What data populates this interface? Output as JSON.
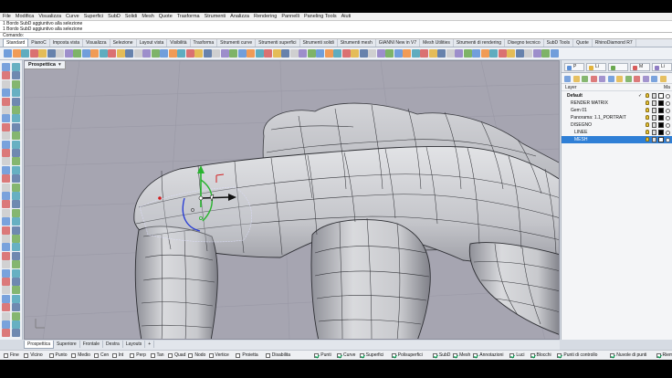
{
  "menu": [
    "File",
    "Modifica",
    "Visualizza",
    "Curve",
    "Superfici",
    "SubD",
    "Solidi",
    "Mesh",
    "Quote",
    "Trasforma",
    "Strumenti",
    "Analizza",
    "Rendering",
    "Pannelli",
    "Paneling Tools",
    "Aiuti"
  ],
  "command_history": [
    "1 Bordo SubD aggiuntivo alla selezione",
    "1 Bordo SubD aggiuntivo alla selezione"
  ],
  "command_prompt": "Comando:",
  "toolbar_tabs": [
    "Standard",
    "PianoC",
    "Imposta vista",
    "Visualizza",
    "Selezione",
    "Layout vista",
    "Visibilità",
    "Trasforma",
    "Strumenti curve",
    "Strumenti superfici",
    "Strumenti solidi",
    "Strumenti mesh",
    "GIANNI New in V7",
    "Mesh Utilities",
    "Strumenti di rendering",
    "Disegno tecnico",
    "SubD Tools",
    "Quote",
    "RhinoDiamond R7"
  ],
  "active_toolbar_tab": 0,
  "viewport": {
    "title": "Prospettica",
    "menu_glyph": "▾"
  },
  "viewport_tabs": [
    "Prospettica",
    "Superiore",
    "Frontale",
    "Destra",
    "Layouts",
    "+"
  ],
  "active_viewport_tab": 0,
  "panel": {
    "tabs": [
      "P",
      "Li",
      "",
      "M",
      "Li"
    ],
    "header": {
      "layer": "Layer",
      "material": "Ma"
    },
    "layers": [
      {
        "name": "Default",
        "indent": 0,
        "bold": true,
        "color": "#ffffff",
        "check": "✓",
        "selected": false
      },
      {
        "name": "RENDER MATRIX",
        "indent": 1,
        "bold": false,
        "color": "#000000",
        "check": "",
        "selected": false
      },
      {
        "name": "Gem 01",
        "indent": 1,
        "bold": false,
        "color": "#000000",
        "check": "",
        "selected": false
      },
      {
        "name": "Panorama: 1.1_PORTRAIT",
        "indent": 1,
        "bold": false,
        "color": "#000000",
        "check": "",
        "selected": false
      },
      {
        "name": "DISEGNO",
        "indent": 1,
        "bold": false,
        "color": "#000000",
        "check": "",
        "selected": false
      },
      {
        "name": "LINEE",
        "indent": 2,
        "bold": false,
        "color": "#000000",
        "check": "",
        "selected": false
      },
      {
        "name": "MESH",
        "indent": 2,
        "bold": false,
        "color": "#ffffff",
        "check": "",
        "selected": true
      }
    ]
  },
  "osnaps": [
    {
      "label": "Fine",
      "on": false
    },
    {
      "label": "Vicino",
      "on": false
    },
    {
      "label": "Punto",
      "on": false
    },
    {
      "label": "Medio",
      "on": false
    },
    {
      "label": "Cen",
      "on": false
    },
    {
      "label": "Int",
      "on": false
    },
    {
      "label": "Perp",
      "on": false
    },
    {
      "label": "Tan",
      "on": false
    },
    {
      "label": "Quad",
      "on": false
    },
    {
      "label": "Nodo",
      "on": false
    },
    {
      "label": "Vertice",
      "on": false
    },
    {
      "label": "Proietta",
      "on": false
    },
    {
      "label": "Disabilita",
      "on": false
    }
  ],
  "filters": [
    {
      "label": "Punti",
      "on": true
    },
    {
      "label": "Curve",
      "on": true
    },
    {
      "label": "Superfici",
      "on": true
    },
    {
      "label": "Polisuperfici",
      "on": true
    },
    {
      "label": "SubD",
      "on": true
    },
    {
      "label": "Mesh",
      "on": true
    },
    {
      "label": "Annotazioni",
      "on": true
    },
    {
      "label": "Luci",
      "on": true
    },
    {
      "label": "Blocchi",
      "on": true
    },
    {
      "label": "Punti di controllo",
      "on": true
    },
    {
      "label": "Nuvole di punti",
      "on": true
    },
    {
      "label": "Riempimenti",
      "on": true
    },
    {
      "label": "Altri",
      "on": true
    },
    {
      "label": "Disabilita",
      "on": false
    }
  ],
  "colors": {
    "viewport_bg": "#a6a5b1",
    "surface_light": "#dcdde0",
    "surface_shadow": "#7d7e86",
    "wire": "#2e2f34",
    "gumball_x": "#d21e1e",
    "gumball_y": "#29b42f",
    "gumball_z": "#2b3fd4",
    "selection": "#2f7fd6"
  }
}
